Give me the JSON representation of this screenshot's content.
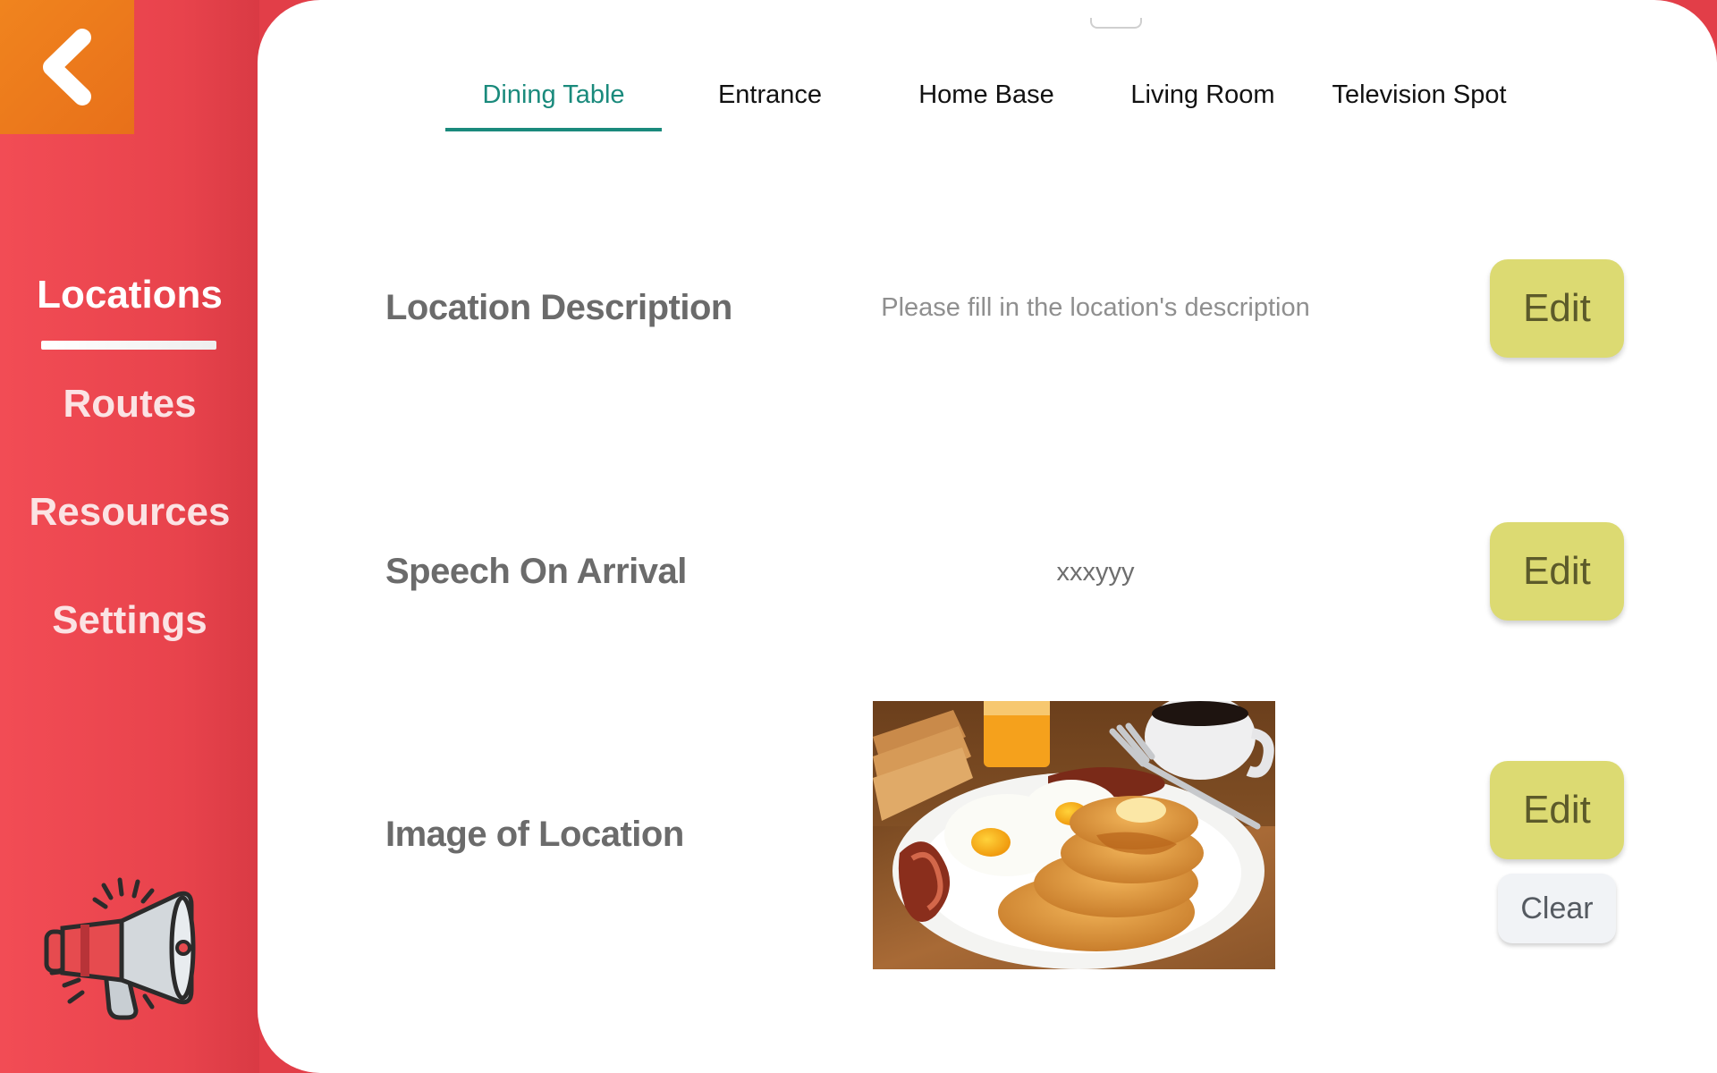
{
  "sidebar": {
    "back_icon": "chevron-left-icon",
    "items": [
      {
        "label": "Locations",
        "active": true
      },
      {
        "label": "Routes",
        "active": false
      },
      {
        "label": "Resources",
        "active": false
      },
      {
        "label": "Settings",
        "active": false
      }
    ],
    "announcement_icon": "megaphone-icon"
  },
  "tabs": [
    {
      "label": "Dining Table",
      "active": true
    },
    {
      "label": "Entrance",
      "active": false
    },
    {
      "label": "Home Base",
      "active": false
    },
    {
      "label": "Living Room",
      "active": false
    },
    {
      "label": "Television Spot",
      "active": false
    }
  ],
  "rows": {
    "description": {
      "label": "Location Description",
      "value": "Please fill in the location's description",
      "edit_label": "Edit"
    },
    "speech": {
      "label": "Speech On Arrival",
      "value": "xxxyyy",
      "edit_label": "Edit"
    },
    "image": {
      "label": "Image of Location",
      "edit_label": "Edit",
      "clear_label": "Clear"
    }
  },
  "colors": {
    "sidebar": "#f24c55",
    "back_button": "#f0841e",
    "active_tab": "#1a8a7c",
    "edit_button": "#dcda72",
    "clear_button": "#f1f3f6"
  }
}
